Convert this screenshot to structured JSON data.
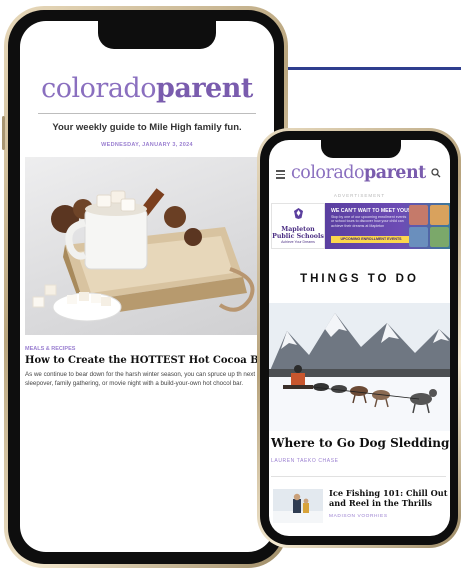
{
  "newsletter": {
    "logo_light": "colorado",
    "logo_bold": "parent",
    "tagline": "Your weekly guide to Mile High family fun.",
    "date": "WEDNESDAY, JANUARY 3, 2024",
    "article": {
      "category": "MEALS & RECIPES",
      "headline": "How to Create the HOTTEST Hot Cocoa Bar at Ho",
      "excerpt": "As we continue to bear down for the harsh winter season, you can spruce up th next sleepover, family gathering, or movie night with a build-your-own hot chocol bar."
    }
  },
  "website": {
    "logo_light": "colorado",
    "logo_bold": "parent",
    "ad_label": "ADVERTISEMENT",
    "ad": {
      "school_name": "Mapleton Public Schools",
      "school_motto": "Achieve Your Dreams",
      "headline": "WE CAN'T WAIT TO MEET YOU!",
      "body": "Stop by one of our upcoming enrollment events or school tours to discover how your child can achieve their dreams at Mapleton",
      "cta": "UPCOMING ENROLLMENT EVENTS"
    },
    "section_title": "THINGS TO DO",
    "feature": {
      "title": "Where to Go Dog Sledding",
      "author": "LAUREN TAEKO CHASE"
    },
    "list_item": {
      "title": "Ice Fishing 101: Chill Out and Reel in the Thrills",
      "author": "MADISON VOORHIES"
    }
  },
  "colors": {
    "brand_purple": "#7a5cae",
    "accent_lavender": "#9a7fd0",
    "deco_blue": "#2f3e8e",
    "ad_yellow": "#fcd74c"
  }
}
